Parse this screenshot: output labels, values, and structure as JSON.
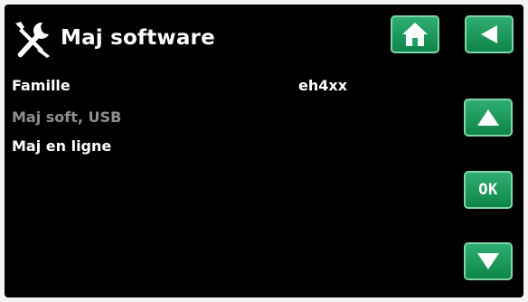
{
  "header": {
    "title": "Maj software",
    "icon": "tools-icon"
  },
  "list": [
    {
      "label": "Famille",
      "value": "eh4xx",
      "enabled": true
    },
    {
      "label": "Maj soft, USB",
      "enabled": false
    },
    {
      "label": "Maj en ligne",
      "enabled": true
    }
  ],
  "buttons": {
    "home": {
      "icon": "home-icon"
    },
    "back": {
      "icon": "back-arrow-icon"
    },
    "up": {
      "icon": "up-arrow-icon"
    },
    "ok": {
      "label": "OK"
    },
    "down": {
      "icon": "down-arrow-icon"
    }
  },
  "colors": {
    "background": "#000000",
    "button": "#1d9a5c",
    "text": "#ffffff",
    "disabled_text": "#8f8f8f"
  }
}
